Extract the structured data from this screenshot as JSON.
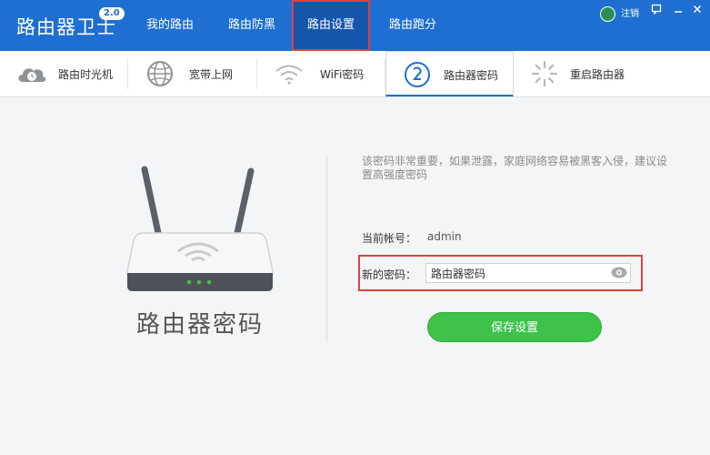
{
  "app": {
    "title": "路由器卫士",
    "version": "2.0"
  },
  "nav": {
    "tabs": [
      {
        "label": "我的路由"
      },
      {
        "label": "路由防黑"
      },
      {
        "label": "路由设置",
        "active": true
      },
      {
        "label": "路由跑分"
      }
    ]
  },
  "window": {
    "logout_label": "注销",
    "icons": [
      "chat-icon",
      "minimize-icon",
      "close-icon"
    ]
  },
  "subnav": {
    "tabs": [
      {
        "label": "路由时光机",
        "icon": "cloud-clock-icon"
      },
      {
        "label": "宽带上网",
        "icon": "globe-icon"
      },
      {
        "label": "WiFi密码",
        "icon": "wifi-icon"
      },
      {
        "label": "路由器密码",
        "icon": "password-icon",
        "active": true
      },
      {
        "label": "重启路由器",
        "icon": "restart-icon"
      }
    ]
  },
  "main": {
    "illustration_label": "路由器密码",
    "hint": "该密码非常重要，如果泄露，家庭网络容易被黑客入侵，建议设置高强度密码",
    "account_label": "当前帐号：",
    "account_value": "admin",
    "new_password_label": "新的密码：",
    "new_password_value": "路由器密码",
    "save_label": "保存设置"
  },
  "colors": {
    "brand": "#1e6fd1",
    "active_tab": "#1556ad",
    "highlight": "#e0413d",
    "save": "#3ec24a"
  }
}
